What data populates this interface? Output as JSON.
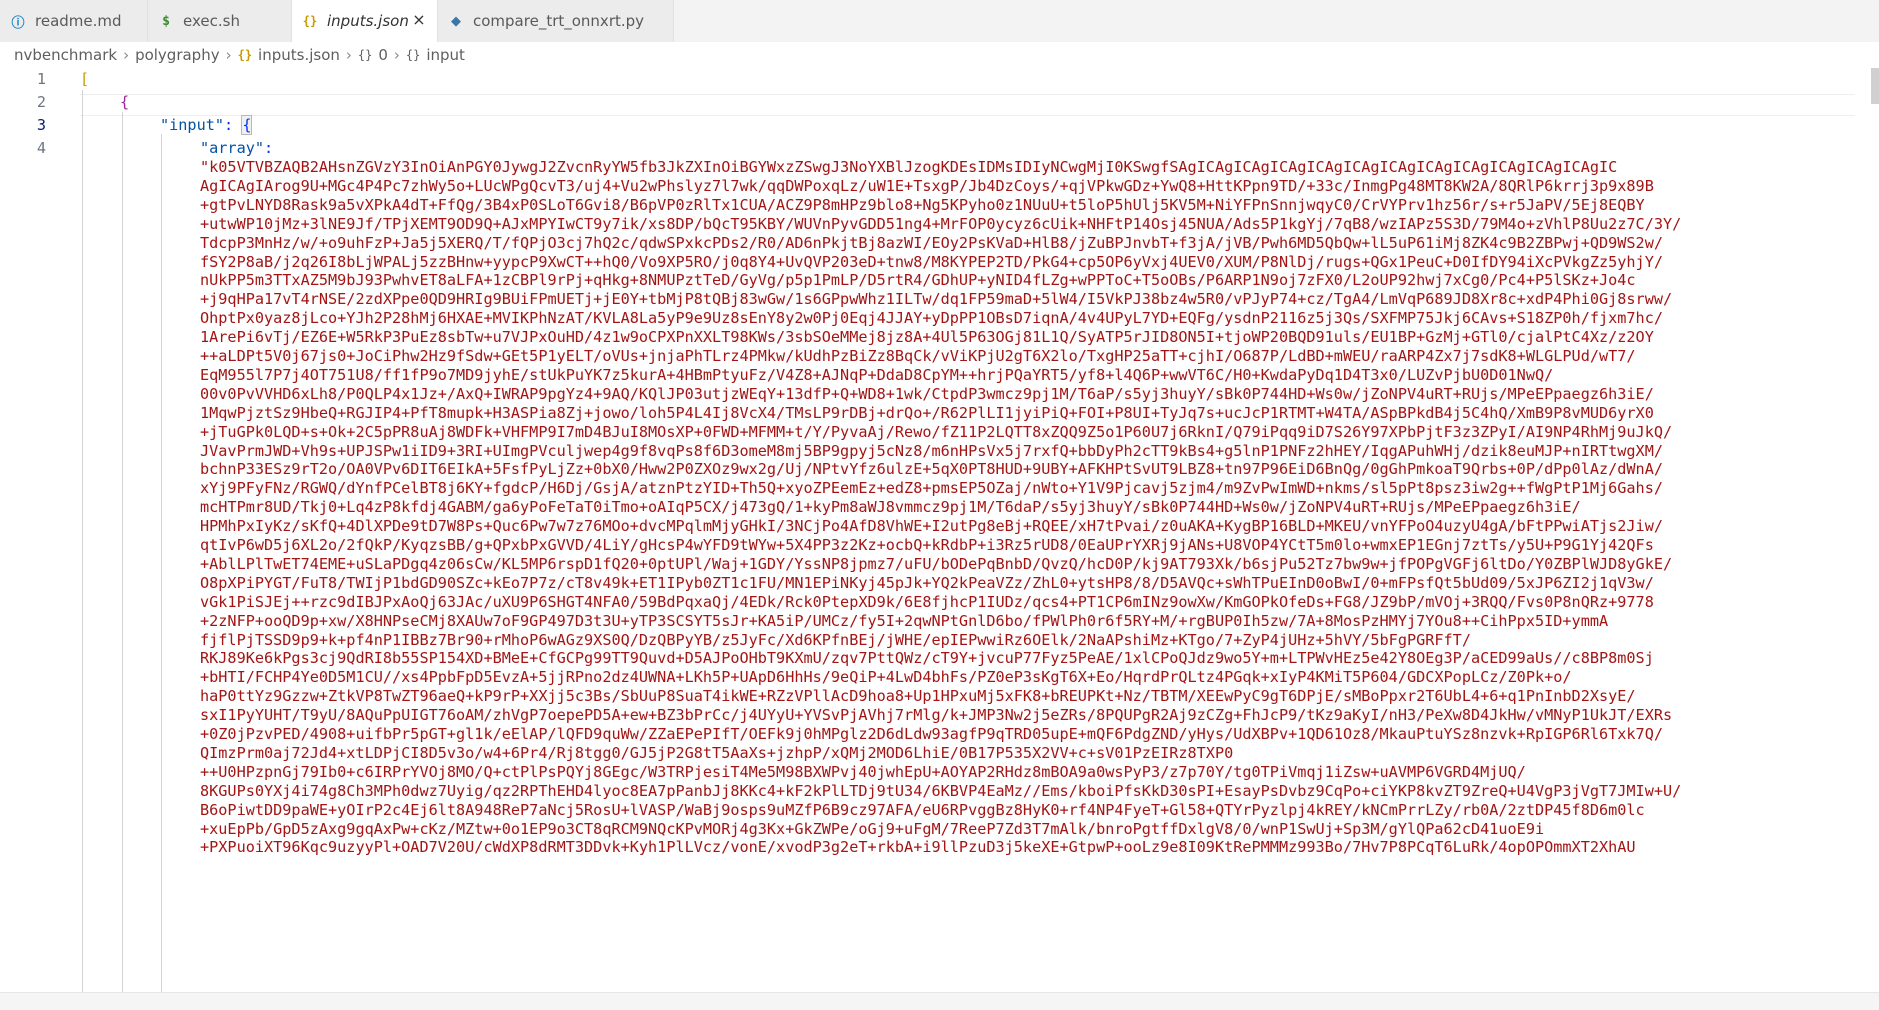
{
  "tabs": [
    {
      "label": "readme.md",
      "icon": "info-icon",
      "active": false
    },
    {
      "label": "exec.sh",
      "icon": "dollar-icon",
      "active": false
    },
    {
      "label": "inputs.json",
      "icon": "json-braces-icon",
      "active": true
    },
    {
      "label": "compare_trt_onnxrt.py",
      "icon": "python-icon",
      "active": false
    }
  ],
  "tab_icons": {
    "info": "ⓘ",
    "dollar": "$",
    "json": "{}",
    "python": "◆",
    "close": "×"
  },
  "breadcrumb": {
    "items": [
      "nvbenchmark",
      "polygraphy",
      "inputs.json",
      "0",
      "input"
    ],
    "sep": "›",
    "json_icon": "{}",
    "obj_icon": "{}"
  },
  "editor": {
    "line_numbers": [
      "1",
      "2",
      "3",
      "4"
    ],
    "current_line": "3",
    "line1": "[",
    "line2": "{",
    "line3_key": "\"input\"",
    "line3_colon": ": ",
    "line3_brace": "{",
    "line4_key": "\"array\"",
    "line4_colon": ":",
    "string_lines": [
      "\"k05VTVBZAQB2AHsnZGVzY3InOiAnPGY0JywgJ2ZvcnRyYW5fb3JkZXInOiBGYWxzZSwgJ3NoYXBlJzogKDEsIDMsIDIyNCwgMjI0KSwgfSAgICAgICAgICAgICAgICAgICAgICAgICAgICAgICAgICAgIC",
      "AgICAgIArog9U+MGc4P4Pc7zhWy5o+LUcWPgQcvT3/uj4+Vu2wPhslyz7l7wk/qqDWPoxqLz/uW1E+TsxgP/Jb4DzCoys/+qjVPkwGDz+YwQ8+HttKPpn9TD/+33c/InmgPg48MT8KW2A/8QRlP6krrj3p9x89B",
      "+gtPvLNYD8Rask9a5vXPkA4dT+FfQg/3B4xP0SLoT6Gvi8/B6pVP0zRlTx1CUA/ACZ9P8mHPz9blo8+Ng5KPyho0z1NUuU+t5loP5hUlj5KV5M+NiYFPnSnnjwqyC0/CrVYPrv1hz56r/s+r5JaPV/5Ej8EQBY",
      "+utwWP10jMz+3lNE9Jf/TPjXEMT9OD9Q+AJxMPYIwCT9y7ik/xs8DP/bQcT95KBY/WUVnPyvGDD51ng4+MrFOP0ycyz6cUik+NHFtP14Osj45NUA/Ads5P1kgYj/7qB8/wzIAPz5S3D/79M4o+zVhlP8Uu2z7C/3Y/",
      "TdcpP3MnHz/w/+o9uhFzP+Ja5j5XERQ/T/fQPjO3cj7hQ2c/qdwSPxkcPDs2/R0/AD6nPkjtBj8azWI/EOy2PsKVaD+HlB8/jZuBPJnvbT+f3jA/jVB/Pwh6MD5QbQw+lL5uP61iMj8ZK4c9B2ZBPwj+QD9WS2w/",
      "fSY2P8aB/j2q26I8bLjWPALj5zzBHnw+yypcP9XwCT++hQ0/Vo9XP5RO/j0q8Y4+UvQVP203eD+tnw8/M8KYPEP2TD/PkG4+cp5OP6yVxj4UEV0/XUM/P8NlDj/rugs+QGx1PeuC+D0IfDY94iXcPVkgZz5yhjY/",
      "nUkPP5m3TTxAZ5M9bJ93PwhvET8aLFA+1zCBPl9rPj+qHkg+8NMUPztTeD/GyVg/p5p1PmLP/D5rtR4/GDhUP+yNID4fLZg+wPPToC+T5oOBs/P6ARP1N9oj7zFX0/L2oUP92hwj7xCg0/Pc4+P5lSKz+Jo4c",
      "+j9qHPa17vT4rNSE/2zdXPpe0QD9HRIg9BUiFPmUETj+jE0Y+tbMjP8tQBj83wGw/1s6GPpwWhz1ILTw/dq1FP59maD+5lW4/I5VkPJ38bz4w5R0/vPJyP74+cz/TgA4/LmVqP689JD8Xr8c+xdP4Phi0Gj8srww/",
      "OhptPx0yaz8jLco+YJh2P28hMj6HXAE+MVIKPhNzAT/KVLA8La5yP9e9Uz8sEnY8y2w0Pj0Eqj4JJAY+yDpPP1OBsD7iqnA/4v4UPyL7YD+EQFg/ysdnP2116z5j3Qs/SXFMP75Jkj6CAvs+S18ZP0h/fjxm7hc/",
      "1ArePi6vTj/EZ6E+W5RkP3PuEz8sbTw+u7VJPxOuHD/4z1w9oCPXPnXXLT98KWs/3sbSOeMMej8jz8A+4Ul5P63OGj81L1Q/SyATP5rJID8ON5I+tjoWP20BQD91uls/EU1BP+GzMj+GTl0/cjalPtC4Xz/z2OY",
      "++aLDPt5V0j67js0+JoCiPhw2Hz9fSdw+GEt5P1yELT/oVUs+jnjaPhTLrz4PMkw/kUdhPzBiZz8BqCk/vViKPjU2gT6X2lo/TxgHP25aTT+cjhI/O687P/LdBD+mWEU/raARP4Zx7j7sdK8+WLGLPUd/wT7/",
      "EqM955l7P7j4OT751U8/ff1fP9o7MD9jyhE/stUkPuYK7z5kurA+4HBmPtyuFz/V4Z8+AJNqP+DdaD8CpYM++hrjPQaYRT5/yf8+l4Q6P+wwVT6C/H0+KwdaPyDq1D4T3x0/LUZvPjbU0D01NwQ/",
      "00v0PvVVHD6xLh8/P0QLP4x1Jz+/AxQ+IWRAP9pgYz4+9AQ/KQlJP03utjzWEqY+13dfP+Q+WD8+1wk/CtpdP3wmcz9pj1M/T6aP/s5yj3huyY/sBk0P744HD+Ws0w/jZoNPV4uRT+RUjs/MPeEPpaegz6h3iE/",
      "1MqwPjztSz9HbeQ+RGJIP4+PfT8mupk+H3ASPia8Zj+jowo/loh5P4L4Ij8VcX4/TMsLP9rDBj+drQo+/R62PlLI1jyiPiQ+FOI+P8UI+TyJq7s+ucJcP1RTMT+W4TA/ASpBPkdB4j5C4hQ/XmB9P8vMUD6yrX0",
      "+jTuGPk0LQD+s+Ok+2C5pPR8uAj8WDFk+VHFMP9I7mD4BJuI8MOsXP+0FWD+MFMM+t/Y/PyvaAj/Rewo/fZ11P2LQTT8xZQQ9Z5o1P60U7j6RknI/Q79iPqq9iD7S26Y97XPbPjtF3z3ZPyI/AI9NP4RhMj9uJkQ/",
      "JVavPrmJWD+Vh9s+UPJSPw1iID9+3RI+UImgPVculjwep4g9f8vqPs8f6D3omeM8mj5BP9gpyj5cNz8/m6nHPsVx5j7rxfQ+bbDyPh2cTT9kBs4+g5lnP1PNFz2hHEY/IqgAPuhWHj/dzik8euMJP+nIRTtwgXM/",
      "bchnP33ESz9rT2o/OA0VPv6DIT6EIkA+5FsfPyLjZz+0bX0/Hww2P0ZXOz9wx2g/Uj/NPtvYfz6ulzE+5qX0PT8HUD+9UBY+AFKHPtSvUT9LBZ8+tn97P96EiD6BnQg/0gGhPmkoaT9Qrbs+0P/dPp0lAz/dWnA/",
      "xYj9PFyFNz/RGWQ/dYnfPCelBT8j6KY+fgdcP/H6Dj/GsjA/atznPtzYID+Th5Q+xyoZPEemEz+edZ8+pmsEP5OZaj/nWto+Y1V9Pjcavj5zjm4/m9ZvPwImWD+nkms/sl5pPt8psz3iw2g++fWgPtP1Mj6Gahs/",
      "mcHTPmr8UD/Tkj0+Lq4zP8kfdj4GABM/ga6yPoFeTaT0iTmo+oAIqP5CX/j473gQ/1+kyPm8aWJ8vmmcz9pj1M/T6daP/s5yj3huyY/sBk0P744HD+Ws0w/jZoNPV4uRT+RUjs/MPeEPpaegz6h3iE/",
      "HPMhPxIyKz/sKfQ+4DlXPDe9tD7W8Ps+Quc6Pw7w7z76MOo+dvcMPqlmMjyGHkI/3NCjPo4AfD8VhWE+I2utPg8eBj+RQEE/xH7tPvai/z0uAKA+KygBP16BLD+MKEU/vnYFPoO4uzyU4gA/bFtPPwiATjs2Jiw/",
      "qtIvP6wD5j6XL2o/2fQkP/KyqzsBB/g+QPxbPxGVVD/4LiY/gHcsP4wYFD9tWYw+5X4PP3z2Kz+ocbQ+kRdbP+i3Rz5rUD8/0EaUPrYXRj9jANs+U8VOP4YCtT5m0lo+wmxEP1EGnj7ztTs/y5U+P9G1Yj42QFs",
      "+AblLPlTwET74EME+uSLaPDgq4z06sCw/KL5MP6rspD1fQ20+0ptUPl/Waj+1GDY/YssNP8jpmz7/uFU/bODePqBnbD/QvzQ/hcD0P/kj9AT793Xk/b6sjPu52Tz7bw9w+jfPOPgVGFj6ltDo/Y0ZBPlWJD8yGkE/",
      "O8pXPiPYGT/FuT8/TWIjP1bdGD90SZc+kEo7P7z/cT8v49k+ET1IPyb0ZT1c1FU/MN1EPiNKyj45pJk+YQ2kPeaVZz/ZhL0+ytsHP8/8/D5AVQc+sWhTPuEInD0oBwI/0+mFPsfQt5bUd09/5xJP6ZI2j1qV3w/",
      "vGk1PiSJEj++rzc9dIBJPxAoQj63JAc/uXU9P6SHGT4NFA0/59BdPqxaQj/4EDk/Rck0PtepXD9k/6E8fjhcP1IUDz/qcs4+PT1CP6mINz9owXw/KmGOPkOfeDs+FG8/JZ9bP/mVOj+3RQQ/Fvs0P8nQRz+9778",
      "+2zNFP+ooQD9p+xw/X8HNPseCMj8XAUw7oF9GP497D3t3U+yTP3SCSYT5sJr+KA5iP/UMCz/fy5I+2qwNPtGnlD6bo/fPWlPh0r6f5RY+M/+rgBUP0Ih5zw/7A+8MosPzHMYj7YOu8++CihPpx5ID+ymmA",
      "fjflPjTSSD9p9+k+pf4nP1IBBz7Br90+rMhoP6wAGz9XS0Q/DzQBPyYB/z5JyFc/Xd6KPfnBEj/jWHE/epIEPwwiRz6OElk/2NaAPshiMz+KTgo/7+ZyP4jUHz+5hVY/5bFgPGRFfT/",
      "RKJ89Ke6kPgs3cj9QdRI8b55SP154XD+BMeE+CfGCPg99TT9Quvd+D5AJPoOHbT9KXmU/zqv7PttQWz/cT9Y+jvcuP77Fyz5PeAE/1xlCPoQJdz9wo5Y+m+LTPWvHEz5e42Y8OEg3P/aCED99aUs//c8BP8m0Sj",
      "+bHTI/FCHP4Ye0D5M1CU//xs4PpbFpD5EvzA+5jjRPno2dz4UWNA+LKh5P+UApD6HhHs/9eQiP+4LwD4bhFs/PZ0eP3sKgT6X+Eo/HqrdPrQLtz4PGqk+xIyP4KMiT5P604/GDCXPopLCz/Z0Pk+o/",
      "haP0ttYz9Gzzw+ZtkVP8TwZT96aeQ+kP9rP+XXjj5c3Bs/SbUuP8SuaT4ikWE+RZzVPllAcD9hoa8+Up1HPxuMj5xFK8+bREUPKt+Nz/TBTM/XEEwPyC9gT6DPjE/sMBoPpxr2T6UbL4+6+q1PnInbD2XsyE/",
      "sxI1PyYUHT/T9yU/8AQuPpUIGT76oAM/zhVgP7oepePD5A+ew+BZ3bPrCc/j4UYyU+YVSvPjAVhj7rMlg/k+JMP3Nw2j5eZRs/8PQUPgR2Aj9zCZg+FhJcP9/tKz9aKyI/nH3/PeXw8D4JkHw/vMNyP1UkJT/EXRs",
      "+0Z0jPzvPED/4908+uifbPr5pGT+gl1k/eElAP/lQFD9quWw/ZZaEPePIfT/OEFk9j0hMPglz2D6dLdw93agfP9qTRD05upE+mQF6PdgZND/yHys/UdXBPv+1QD61Oz8/MkauPtuYSz8nzvk+RpIGP6Rl6Txk7Q/",
      "QImzPrm0aj72Jd4+xtLDPjCI8D5v3o/w4+6Pr4/Rj8tgg0/GJ5jP2G8tT5AaXs+jzhpP/xQMj2MOD6LhiE/0B17P535X2VV+c+sV01PzEIRz8TXP0",
      "++U0HPzpnGj79Ib0+c6IRPrYVOj8MO/Q+ctPlPsPQYj8GEgc/W3TRPjesiT4Me5M98BXWPvj40jwhEpU+AOYAP2RHdz8mBOA9a0wsPyP3/z7p70Y/tg0TPiVmqj1iZsw+uAVMP6VGRD4MjUQ/",
      "8KGUPs0YXj4i74g8Ch3MPh0dwz7Uyig/qz2RPThEHD4lyoc8EA7pPanbJj8KKc4+kF2kPlLTDj9tU34/6KBVP4EaMz//Ems/kboiPfsKkD30sPI+EsayPsDvbz9CqPo+ciYKP8kvZT9ZreQ+U4VgP3jVgT7JMIw+U/",
      "B6oPiwtDD9paWE+yOIrP2c4Ej6lt8A948ReP7aNcj5RosU+lVASP/WaBj9osps9uMZfP6B9cz97AFA/eU6RPvggBz8HyK0+rf4NP4FyeT+Gl58+QTYrPyzlpj4kREY/kNCmPrrLZy/rb0A/2ztDP45f8D6m0lc",
      "+xuEpPb/GpD5zAxg9gqAxPw+cKz/MZtw+0o1EP9o3CT8qRCM9NQcKPvMORj4g3Kx+GkZWPe/oGj9+uFgM/7ReeP7Zd3T7mAlk/bnroPgtffDxlgV8/0/wnP1SwUj+Sp3M/gYlQPa62cD41uoE9i",
      "+PXPuoiXT96Kqc9uzyyPl+OAD7V20U/cWdXP8dRMT3DDvk+Kyh1PlLVcz/vonE/xvodP3g2eT+rkbA+i9llPzuD3j5keXE+GtpwP+ooLz9e8I09KtRePMMMz993Bo/7Hv7P8PCqT6LuRk/4opOPOmmXT2XhAU"
    ]
  }
}
